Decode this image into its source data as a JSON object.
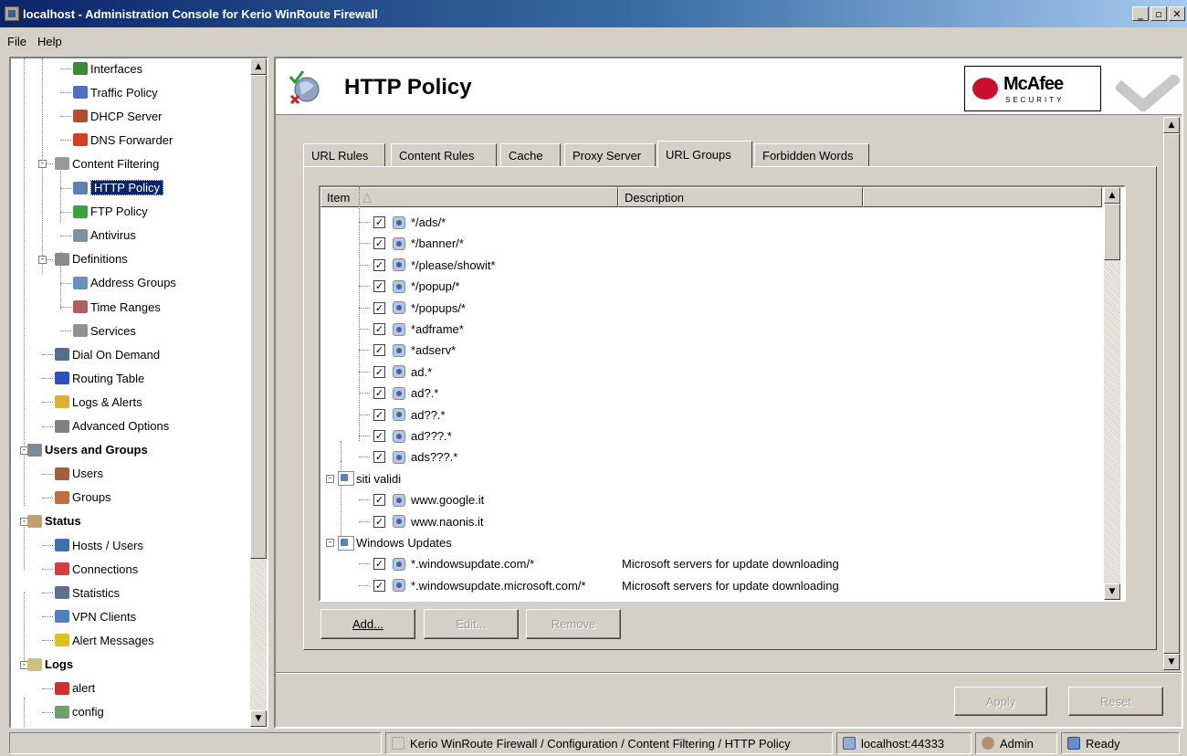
{
  "window": {
    "title": "localhost - Administration Console for Kerio WinRoute Firewall",
    "minimize": "_",
    "maximize": "▫",
    "close": "✕"
  },
  "menu": [
    "File",
    "Help"
  ],
  "tree": {
    "items": [
      {
        "label": "Interfaces",
        "icon": "network-card-icon"
      },
      {
        "label": "Traffic Policy",
        "icon": "traffic-policy-icon"
      },
      {
        "label": "DHCP Server",
        "icon": "dhcp-server-icon"
      },
      {
        "label": "DNS Forwarder",
        "icon": "dns-forwarder-icon"
      },
      {
        "label": "Content Filtering",
        "icon": "content-filtering-icon"
      },
      {
        "label": "HTTP Policy",
        "icon": "http-policy-icon"
      },
      {
        "label": "FTP Policy",
        "icon": "ftp-policy-icon"
      },
      {
        "label": "Antivirus",
        "icon": "antivirus-icon"
      },
      {
        "label": "Definitions",
        "icon": "definitions-icon"
      },
      {
        "label": "Address Groups",
        "icon": "address-groups-icon"
      },
      {
        "label": "Time Ranges",
        "icon": "time-ranges-icon"
      },
      {
        "label": "Services",
        "icon": "services-icon"
      },
      {
        "label": "Dial On Demand",
        "icon": "dial-on-demand-icon"
      },
      {
        "label": "Routing Table",
        "icon": "routing-table-icon"
      },
      {
        "label": "Logs & Alerts",
        "icon": "logs-alerts-icon"
      },
      {
        "label": "Advanced Options",
        "icon": "advanced-options-icon"
      },
      {
        "label": "Users and Groups",
        "icon": "users-groups-icon"
      },
      {
        "label": "Users",
        "icon": "user-icon"
      },
      {
        "label": "Groups",
        "icon": "groups-icon"
      },
      {
        "label": "Status",
        "icon": "status-icon"
      },
      {
        "label": "Hosts / Users",
        "icon": "hosts-users-icon"
      },
      {
        "label": "Connections",
        "icon": "connections-icon"
      },
      {
        "label": "Statistics",
        "icon": "statistics-icon"
      },
      {
        "label": "VPN Clients",
        "icon": "vpn-clients-icon"
      },
      {
        "label": "Alert Messages",
        "icon": "alert-messages-icon"
      },
      {
        "label": "Logs",
        "icon": "logs-icon"
      },
      {
        "label": "alert",
        "icon": "alert-log-icon"
      },
      {
        "label": "config",
        "icon": "config-log-icon"
      }
    ]
  },
  "header": {
    "title": "HTTP Policy",
    "brand": "McAfee",
    "brand_sub": "SECURITY"
  },
  "tabs": [
    "URL Rules",
    "Content Rules",
    "Cache",
    "Proxy Server",
    "URL Groups",
    "Forbidden Words"
  ],
  "active_tab": "URL Groups",
  "list": {
    "columns": [
      "Item",
      "Description",
      ""
    ],
    "rows": [
      {
        "type": "url",
        "checked": true,
        "text": "*/ads/*",
        "description": ""
      },
      {
        "type": "url",
        "checked": true,
        "text": "*/banner/*",
        "description": ""
      },
      {
        "type": "url",
        "checked": true,
        "text": "*/please/showit*",
        "description": ""
      },
      {
        "type": "url",
        "checked": true,
        "text": "*/popup/*",
        "description": ""
      },
      {
        "type": "url",
        "checked": true,
        "text": "*/popups/*",
        "description": ""
      },
      {
        "type": "url",
        "checked": true,
        "text": "*adframe*",
        "description": ""
      },
      {
        "type": "url",
        "checked": true,
        "text": "*adserv*",
        "description": ""
      },
      {
        "type": "url",
        "checked": true,
        "text": "ad.*",
        "description": ""
      },
      {
        "type": "url",
        "checked": true,
        "text": "ad?.*",
        "description": ""
      },
      {
        "type": "url",
        "checked": true,
        "text": "ad??.*",
        "description": ""
      },
      {
        "type": "url",
        "checked": true,
        "text": "ad???.*",
        "description": ""
      },
      {
        "type": "url",
        "checked": true,
        "text": "ads???.*",
        "description": ""
      },
      {
        "type": "group",
        "text": "siti validi"
      },
      {
        "type": "url",
        "checked": true,
        "text": "www.google.it",
        "description": ""
      },
      {
        "type": "url",
        "checked": true,
        "text": "www.naonis.it",
        "description": ""
      },
      {
        "type": "group",
        "text": "Windows Updates"
      },
      {
        "type": "url",
        "checked": true,
        "text": "*.windowsupdate.com/*",
        "description": "Microsoft servers for update downloading"
      },
      {
        "type": "url",
        "checked": true,
        "text": "*.windowsupdate.microsoft.com/*",
        "description": "Microsoft servers for update downloading"
      }
    ]
  },
  "buttons": {
    "add": "Add...",
    "edit": "Edit...",
    "remove": "Remove",
    "apply": "Apply",
    "reset": "Reset"
  },
  "statusbar": {
    "path": "Kerio WinRoute Firewall / Configuration / Content Filtering / HTTP Policy",
    "server": "localhost:44333",
    "user": "Admin",
    "state": "Ready"
  },
  "colors": {
    "selection": "#0a246a",
    "face": "#d4d0c8",
    "brand_red": "#c8102e"
  }
}
